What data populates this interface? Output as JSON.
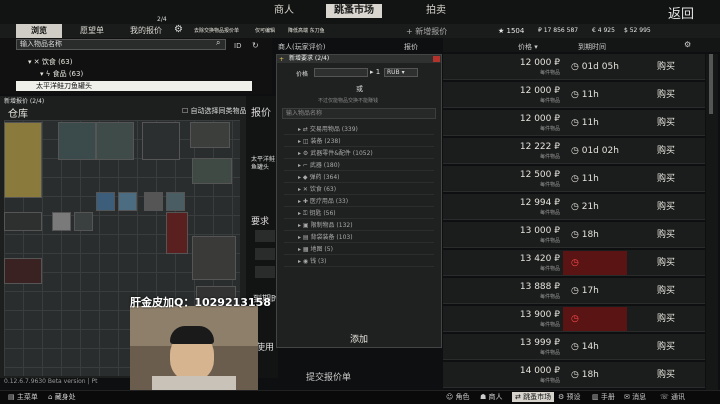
{
  "topbar": {
    "tabs": [
      "商人",
      "跳蚤市场",
      "拍卖"
    ],
    "back": "返回",
    "currency_roubles": "17 856 587",
    "currency_euros": "4 925",
    "currency_dollars": "52 995",
    "level": "1504"
  },
  "subbar": {
    "browse": "浏览",
    "wishlist": "愿望单",
    "my_offers": "我的报价",
    "offers_count": "2/4",
    "filter1": "去除交换物品报价单",
    "filter2": "仅可编辑",
    "filter3": "降低高端 东刀鱼",
    "add_offer": "+ 新增报价",
    "col_seller": "商人(玩家评价)",
    "col_offer": "报价",
    "col_price": "价格",
    "col_expire": "到期时间",
    "col_id": "ID"
  },
  "left": {
    "search_placeholder": "输入物品名称",
    "tree": [
      "饮食 (63)",
      "食品 (63)",
      "太平洋鲑刀鱼罐头"
    ]
  },
  "stash": {
    "title": "新增报价 (2/4)",
    "label": "仓库",
    "auto_select": "自动选择同类物品",
    "report": "报价",
    "item_title": "太平洋鲑",
    "item_sub": "鱼罐头",
    "requirements": "要求",
    "duration": "到期时",
    "use": "使用",
    "submit": "提交报价单",
    "version": "0.12.6.7.9630 Beta version | Pt"
  },
  "dialog": {
    "title": "新增要求 (2/4)",
    "condition": "价格",
    "currency": "RUB",
    "or": "或",
    "hint": "不过仅能物品交换不能赚钱",
    "search_placeholder": "输入物品名称",
    "categories": [
      "交易用物品 (339)",
      "装备 (238)",
      "武器零件&配件 (1052)",
      "武器 (180)",
      "弹药 (364)",
      "饮食 (63)",
      "医疗用品 (33)",
      "钥匙 (56)",
      "限制物品 (132)",
      "背袋装备 (103)",
      "地图 (5)",
      "钱 (3)"
    ],
    "add": "添加"
  },
  "rows": [
    {
      "price": "12 000",
      "time": "01d 05h",
      "red": false
    },
    {
      "price": "12 000",
      "time": "11h",
      "red": false
    },
    {
      "price": "12 000",
      "time": "11h",
      "red": false
    },
    {
      "price": "12 222",
      "time": "01d 02h",
      "red": false
    },
    {
      "price": "12 500",
      "time": "11h",
      "red": false
    },
    {
      "price": "12 994",
      "time": "21h",
      "red": false
    },
    {
      "price": "13 000",
      "time": "18h",
      "red": false
    },
    {
      "price": "13 420",
      "time": "",
      "red": true
    },
    {
      "price": "13 888",
      "time": "17h",
      "red": false
    },
    {
      "price": "13 900",
      "time": "",
      "red": true
    },
    {
      "price": "13 999",
      "time": "14h",
      "red": false
    },
    {
      "price": "14 000",
      "time": "18h",
      "red": false
    }
  ],
  "row_labels": {
    "sub": "每件物品",
    "buy": "购买",
    "rub": "₽"
  },
  "overlay": {
    "qq": "肝金皮加Q：1029213158"
  },
  "bottombar": [
    "主菜单",
    "藏身处",
    "角色",
    "商人",
    "跳蚤市场",
    "预设",
    "手册",
    "消息",
    "通讯"
  ]
}
